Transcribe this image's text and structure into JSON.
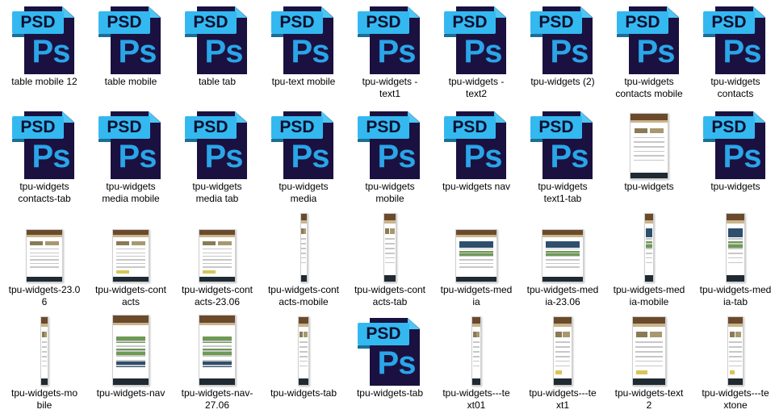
{
  "colors": {
    "psd_page": "#1a1140",
    "psd_banner": "#34b8f0",
    "psd_ps": "#2aa5e8",
    "background": "#ffffff"
  },
  "icon_text": {
    "badge": "PSD",
    "logo": "Ps"
  },
  "files": [
    {
      "name": "table mobile 12",
      "icon": "psd-icon"
    },
    {
      "name": "table mobile",
      "icon": "psd-icon"
    },
    {
      "name": "table tab",
      "icon": "psd-icon"
    },
    {
      "name": "tpu-text mobile",
      "icon": "psd-icon"
    },
    {
      "name": "tpu-widgets - text1",
      "icon": "psd-icon"
    },
    {
      "name": "tpu-widgets - text2",
      "icon": "psd-icon"
    },
    {
      "name": "tpu-widgets (2)",
      "icon": "psd-icon"
    },
    {
      "name": "tpu-widgets contacts mobile",
      "icon": "psd-icon"
    },
    {
      "name": "tpu-widgets contacts",
      "icon": "psd-icon"
    },
    {
      "name": "tpu-widgets contacts-tab",
      "icon": "psd-icon"
    },
    {
      "name": "tpu-widgets media mobile",
      "icon": "psd-icon"
    },
    {
      "name": "tpu-widgets media tab",
      "icon": "psd-icon"
    },
    {
      "name": "tpu-widgets media",
      "icon": "psd-icon"
    },
    {
      "name": "tpu-widgets mobile",
      "icon": "psd-icon"
    },
    {
      "name": "tpu-widgets nav",
      "icon": "psd-icon"
    },
    {
      "name": "tpu-widgets text1-tab",
      "icon": "psd-icon"
    },
    {
      "name": "tpu-widgets",
      "icon": "image-thumbnail-icon"
    },
    {
      "name": "tpu-widgets",
      "icon": "psd-icon"
    },
    {
      "name": "tpu-widgets-23.06",
      "icon": "image-thumbnail-icon"
    },
    {
      "name": "tpu-widgets-contacts",
      "icon": "image-thumbnail-icon"
    },
    {
      "name": "tpu-widgets-contacts-23.06",
      "icon": "image-thumbnail-icon"
    },
    {
      "name": "tpu-widgets-contacts-mobile",
      "icon": "image-thumbnail-icon"
    },
    {
      "name": "tpu-widgets-contacts-tab",
      "icon": "image-thumbnail-icon"
    },
    {
      "name": "tpu-widgets-media",
      "icon": "image-thumbnail-icon"
    },
    {
      "name": "tpu-widgets-media-23.06",
      "icon": "image-thumbnail-icon"
    },
    {
      "name": "tpu-widgets-media-mobile",
      "icon": "image-thumbnail-icon"
    },
    {
      "name": "tpu-widgets-media-tab",
      "icon": "image-thumbnail-icon"
    },
    {
      "name": "tpu-widgets-mobile",
      "icon": "image-thumbnail-icon"
    },
    {
      "name": "tpu-widgets-nav",
      "icon": "image-thumbnail-icon"
    },
    {
      "name": "tpu-widgets-nav-27.06",
      "icon": "image-thumbnail-icon"
    },
    {
      "name": "tpu-widgets-tab",
      "icon": "image-thumbnail-icon"
    },
    {
      "name": "tpu-widgets-tab",
      "icon": "psd-icon"
    },
    {
      "name": "tpu-widgets---text01",
      "icon": "image-thumbnail-icon"
    },
    {
      "name": "tpu-widgets---text1",
      "icon": "image-thumbnail-icon"
    },
    {
      "name": "tpu-widgets-text2",
      "icon": "image-thumbnail-icon"
    },
    {
      "name": "tpu-widgets---textone",
      "icon": "image-thumbnail-icon"
    }
  ]
}
